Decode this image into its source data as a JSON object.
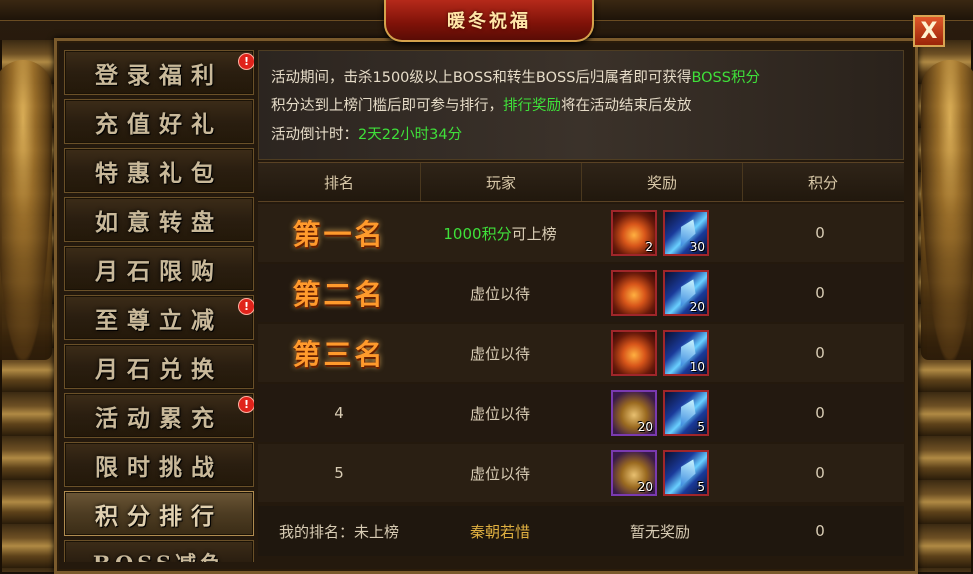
{
  "window": {
    "title": "暖冬祝福",
    "close_label": "X"
  },
  "sidebar": {
    "items": [
      {
        "label": "登录福利",
        "badge": "!",
        "active": false
      },
      {
        "label": "充值好礼",
        "badge": "",
        "active": false
      },
      {
        "label": "特惠礼包",
        "badge": "",
        "active": false
      },
      {
        "label": "如意转盘",
        "badge": "",
        "active": false
      },
      {
        "label": "月石限购",
        "badge": "",
        "active": false
      },
      {
        "label": "至尊立减",
        "badge": "!",
        "active": false
      },
      {
        "label": "月石兑换",
        "badge": "",
        "active": false
      },
      {
        "label": "活动累充",
        "badge": "!",
        "active": false
      },
      {
        "label": "限时挑战",
        "badge": "",
        "active": false
      },
      {
        "label": "积分排行",
        "badge": "",
        "active": true
      },
      {
        "label": "BOSS减负",
        "badge": "",
        "active": false
      }
    ]
  },
  "info": {
    "line1_prefix": "活动期间，击杀1500级以上BOSS和转生BOSS后归属者即可获得",
    "line1_highlight": "BOSS积分",
    "line2_prefix": "积分达到上榜门槛后即可参与排行，",
    "line2_highlight": "排行奖励",
    "line2_suffix": "将在活动结束后发放",
    "line3_prefix": "活动倒计时：",
    "line3_highlight": "2天22小时34分"
  },
  "table": {
    "headers": [
      "排名",
      "玩家",
      "奖励",
      "积分"
    ],
    "rows": [
      {
        "rank": "第一名",
        "player_highlight": "1000积分",
        "player": "可上榜",
        "rewards": [
          {
            "type": "potion",
            "qty": "2"
          },
          {
            "type": "gem",
            "qty": "30"
          }
        ],
        "score": "0"
      },
      {
        "rank": "第二名",
        "player_highlight": "",
        "player": "虚位以待",
        "rewards": [
          {
            "type": "potion",
            "qty": ""
          },
          {
            "type": "gem",
            "qty": "20"
          }
        ],
        "score": "0"
      },
      {
        "rank": "第三名",
        "player_highlight": "",
        "player": "虚位以待",
        "rewards": [
          {
            "type": "potion",
            "qty": ""
          },
          {
            "type": "gem",
            "qty": "10"
          }
        ],
        "score": "0"
      },
      {
        "rank": "4",
        "player_highlight": "",
        "player": "虚位以待",
        "rewards": [
          {
            "type": "chest",
            "qty": "20"
          },
          {
            "type": "gem",
            "qty": "5"
          }
        ],
        "score": "0"
      },
      {
        "rank": "5",
        "player_highlight": "",
        "player": "虚位以待",
        "rewards": [
          {
            "type": "chest",
            "qty": "20"
          },
          {
            "type": "gem",
            "qty": "5"
          }
        ],
        "score": "0"
      }
    ],
    "me": {
      "rank_label": "我的排名：未上榜",
      "player": "秦朝若惜",
      "reward": "暂无奖励",
      "score": "0"
    }
  },
  "colors": {
    "highlight_green": "#3fe03a",
    "rank_orange": "#ff9a2c",
    "player_gold": "#e0b040",
    "badge_red": "#e0231b"
  }
}
